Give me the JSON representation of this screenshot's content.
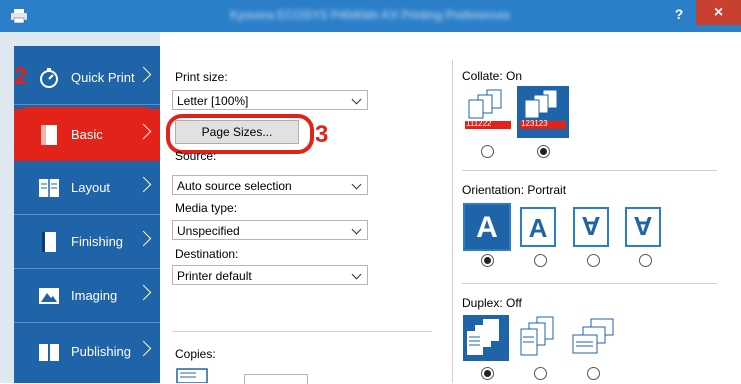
{
  "window": {
    "title": "Kyocera ECOSYS P4040dn KX Printing Preferences",
    "help": "?",
    "close": "×"
  },
  "sidebar": {
    "items": [
      {
        "label": "Quick Print",
        "icon": "stopwatch-icon"
      },
      {
        "label": "Basic",
        "icon": "page-icon"
      },
      {
        "label": "Layout",
        "icon": "layout-icon"
      },
      {
        "label": "Finishing",
        "icon": "finishing-icon"
      },
      {
        "label": "Imaging",
        "icon": "imaging-icon"
      },
      {
        "label": "Publishing",
        "icon": "publishing-icon"
      }
    ]
  },
  "annotations": {
    "step2": "2",
    "step3": "3"
  },
  "basic": {
    "print_size_label": "Print size:",
    "print_size_value": "Letter  [100%]",
    "page_sizes_button": "Page Sizes...",
    "source_label": "Source:",
    "source_value": "Auto source selection",
    "media_type_label": "Media type:",
    "media_type_value": "Unspecified",
    "destination_label": "Destination:",
    "destination_value": "Printer default",
    "copies_label": "Copies:"
  },
  "right": {
    "collate_label": "Collate:  On",
    "collate_uncollated_text": "111222",
    "collate_collated_text": "123123",
    "orientation_label": "Orientation:  Portrait",
    "orientation_glyph": "A",
    "duplex_label": "Duplex:  Off"
  },
  "colors": {
    "accent": "#1f63a8",
    "highlight": "#e2231a",
    "titlebar": "#2b7fc9"
  }
}
